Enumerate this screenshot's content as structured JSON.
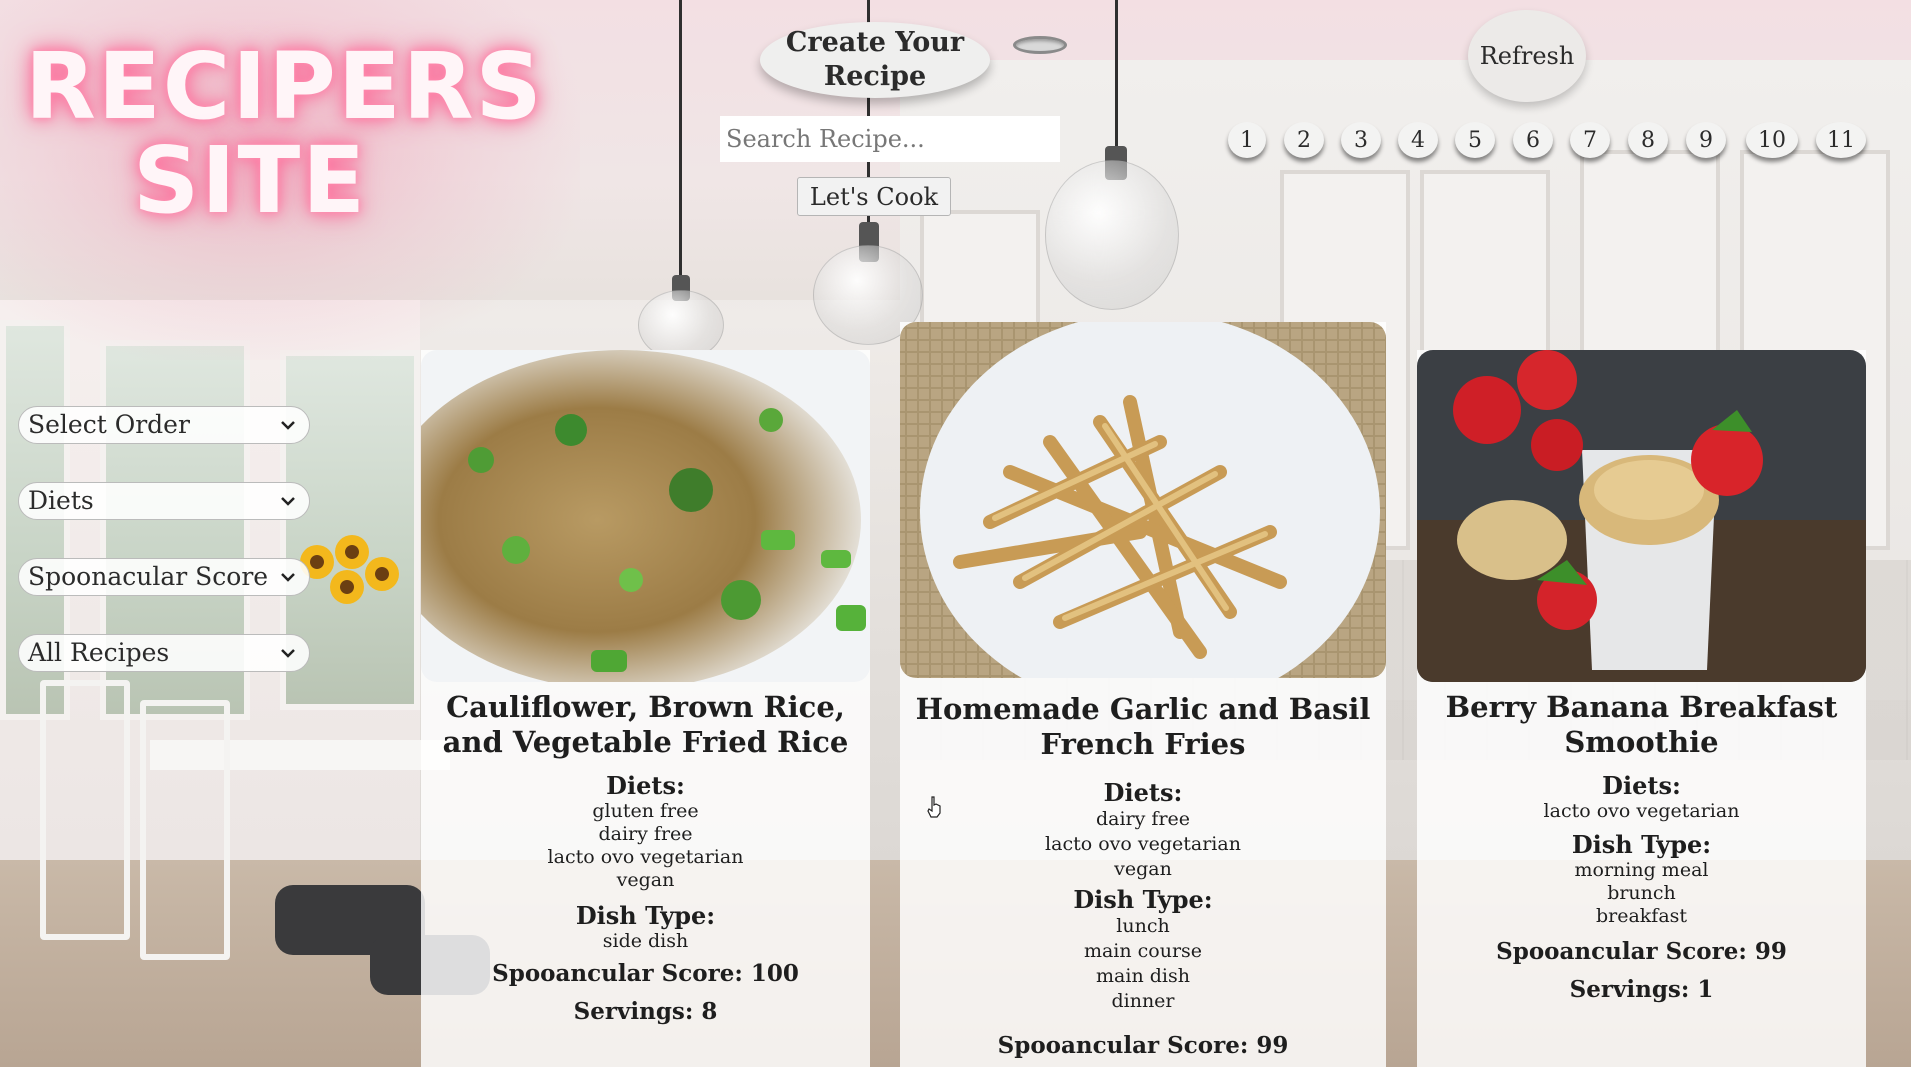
{
  "logo": {
    "line1": "RECIPERS",
    "line2": "SITE"
  },
  "header": {
    "create_label": "Create Your Recipe",
    "search_placeholder": "Search Recipe...",
    "cook_label": "Let's Cook",
    "refresh_label": "Refresh"
  },
  "pagination": [
    "1",
    "2",
    "3",
    "4",
    "5",
    "6",
    "7",
    "8",
    "9",
    "10",
    "11"
  ],
  "filters": [
    {
      "label": "Select Order"
    },
    {
      "label": "Diets"
    },
    {
      "label": "Spoonacular Score"
    },
    {
      "label": "All Recipes"
    }
  ],
  "recipes": [
    {
      "title": "Cauliflower, Brown Rice, and Vegetable Fried Rice",
      "diets_label": "Diets:",
      "diets": [
        "gluten free",
        "dairy free",
        "lacto ovo vegetarian",
        "vegan"
      ],
      "dish_label": "Dish Type:",
      "dish_types": [
        "side dish"
      ],
      "score_text": "Spooancular Score: 100",
      "servings_text": "Servings: 8"
    },
    {
      "title": "Homemade Garlic and Basil French Fries",
      "diets_label": "Diets:",
      "diets": [
        "dairy free",
        "lacto ovo vegetarian",
        "vegan"
      ],
      "dish_label": "Dish Type:",
      "dish_types": [
        "lunch",
        "main course",
        "main dish",
        "dinner"
      ],
      "score_text": "Spooancular Score: 99"
    },
    {
      "title": "Berry Banana Breakfast Smoothie",
      "diets_label": "Diets:",
      "diets": [
        "lacto ovo vegetarian"
      ],
      "dish_label": "Dish Type:",
      "dish_types": [
        "morning meal",
        "brunch",
        "breakfast"
      ],
      "score_text": "Spooancular Score: 99",
      "servings_text": "Servings: 1"
    }
  ],
  "colors": {
    "neon_pink": "#ff6f9c",
    "card_bg": "#ffffff"
  },
  "icons": {
    "select_arrow": "chevron-down-icon",
    "cursor": "hand-pointer-icon"
  }
}
